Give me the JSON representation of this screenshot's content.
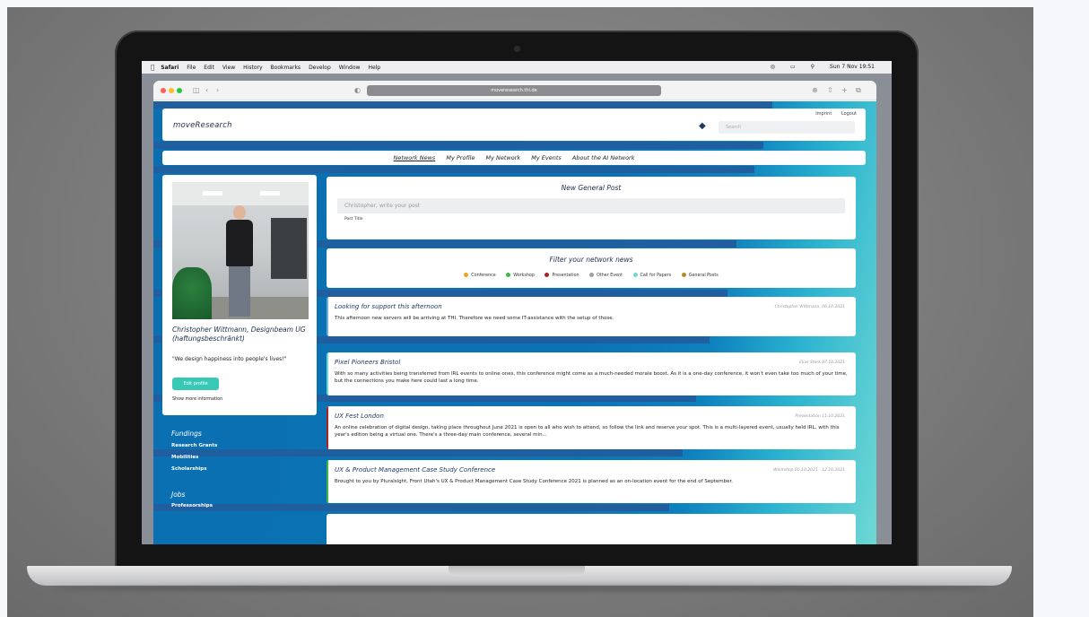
{
  "menubar": {
    "items": [
      "Safari",
      "File",
      "Edit",
      "View",
      "History",
      "Bookmarks",
      "Develop",
      "Window",
      "Help"
    ],
    "clock": "Sun 7 Nov 19:51"
  },
  "browser": {
    "url": "moveresearch.thi.de"
  },
  "site": {
    "logo": "moveResearch",
    "imprint": "Imprint",
    "logout": "Logout",
    "search_placeholder": "Search",
    "nav": [
      "Network News",
      "My Profile",
      "My Network",
      "My Events",
      "About the AI Network"
    ]
  },
  "profile": {
    "name": "Christopher Wittmann, Designbeam UG (haftungsbeschränkt)",
    "quote": "\"We design happiness into people's lives!\"",
    "edit_button": "Edit profile",
    "more_info": "Show more information"
  },
  "sidebar": {
    "fundings_heading": "Fundings",
    "fundings": [
      "Research Grants",
      "Mobilities",
      "Scholarships"
    ],
    "jobs_heading": "Jobs",
    "jobs": [
      "Professorships"
    ]
  },
  "post": {
    "title": "New General Post",
    "placeholder": "Christopher, write your post",
    "sub": "Post Title"
  },
  "filter": {
    "title": "Filter your network news",
    "items": [
      {
        "label": "Conference",
        "color": "#f0a020"
      },
      {
        "label": "Workshop",
        "color": "#3cb84a"
      },
      {
        "label": "Presentation",
        "color": "#b02020"
      },
      {
        "label": "Other Event",
        "color": "#9aa0a6"
      },
      {
        "label": "Call for Papers",
        "color": "#6fd8d4"
      },
      {
        "label": "General Posts",
        "color": "#b08a2a"
      }
    ]
  },
  "news": [
    {
      "title": "Looking for support this afternoon",
      "meta": "Christopher Wittmann, 06.10.2021",
      "body": "This afternoon new servers will be arriving at THI. Therefore we need some IT-assistance with the setup of those.",
      "color": "#6fb0e0"
    },
    {
      "title": "Pixel Pioneers Bristol",
      "meta": "Elias Sterk 07.10.2021",
      "body": "With so many activities being transferred from IRL events to online ones, this conference might come as a much-needed morale boost. As it is a one-day conference, it won't even take too much of your time, but the connections you make here could last a long time.",
      "color": "#6fd8d4"
    },
    {
      "title": "UX Fest London",
      "meta": "Presentation 11.10.2021",
      "body": "An online celebration of digital design, taking place throughout June 2021 is open to all who wish to attend, so follow the link and reserve your spot. This is a multi-layered event, usually held IRL, with this year's edition being a virtual one. There's a three-day main conference, several min...",
      "color": "#b02020"
    },
    {
      "title": "UX & Product Management Case Study Conference",
      "meta": "Workshop 05.10.2021 - 12.10.2021",
      "body": "Brought to you by Pluralsight, Front Utah's UX & Product Management Case Study Conference 2021 is planned as an on-location event for the end of September.",
      "color": "#3cb84a"
    }
  ]
}
